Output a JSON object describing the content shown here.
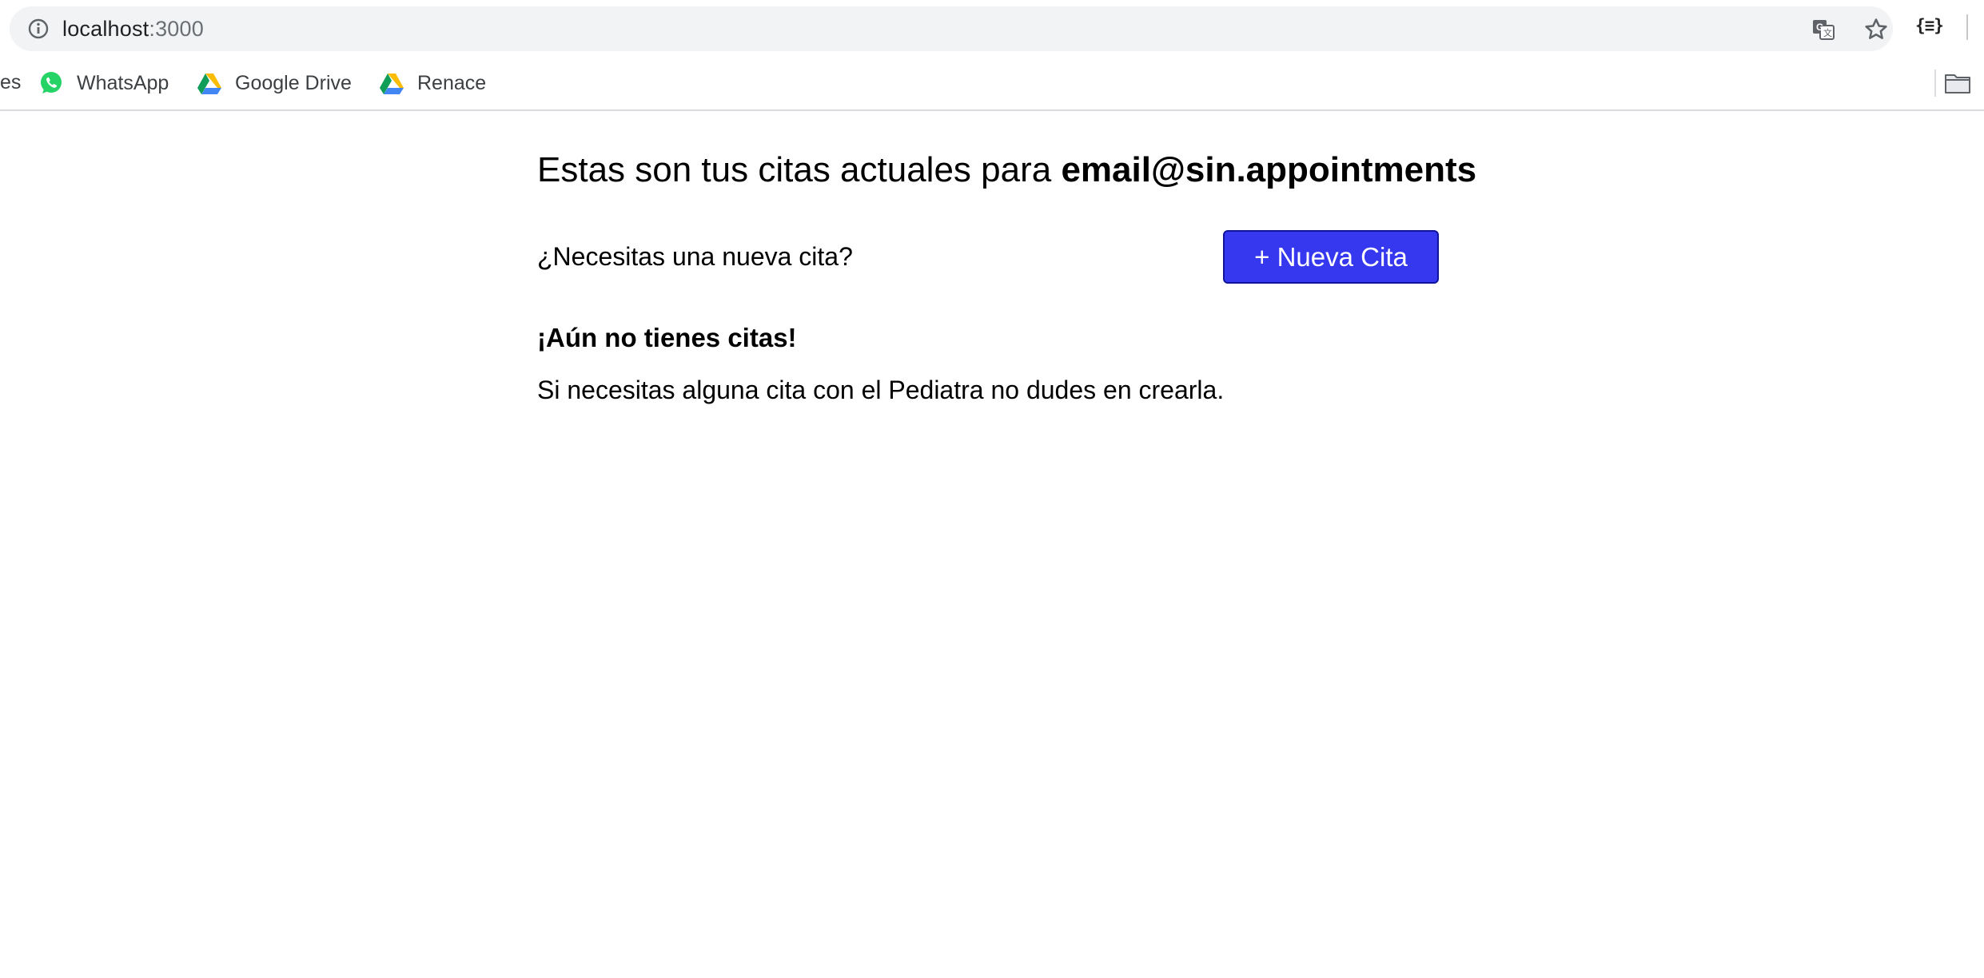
{
  "browser": {
    "url_host": "localhost",
    "url_port": ":3000",
    "bookmarks": {
      "partial_left": "es",
      "items": [
        {
          "label": "WhatsApp",
          "icon": "whatsapp-icon"
        },
        {
          "label": "Google Drive",
          "icon": "google-drive-icon"
        },
        {
          "label": "Renace",
          "icon": "google-drive-icon"
        }
      ]
    },
    "toolbar_icons": [
      "info-icon",
      "translate-icon",
      "star-icon",
      "extension-json-icon",
      "folder-icon"
    ],
    "extension_label": "{≡}"
  },
  "page": {
    "heading_prefix": "Estas son tus citas actuales para ",
    "heading_email": "email@sin.appointments",
    "need_text": "¿Necesitas una nueva cita?",
    "new_button_label": "+ Nueva Cita",
    "empty_title": "¡Aún no tienes citas!",
    "empty_description": "Si necesitas alguna cita con el Pediatra no dudes en crearla."
  },
  "colors": {
    "button_bg": "#3538ee",
    "button_border": "#10149a",
    "omnibox_bg": "#f1f3f4"
  }
}
